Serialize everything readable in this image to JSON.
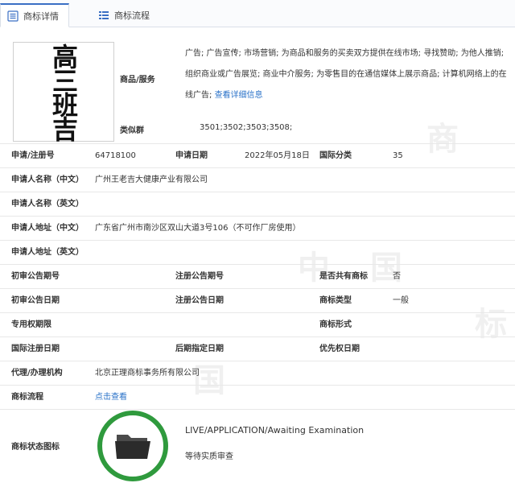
{
  "tabs": [
    {
      "label": "商标详情",
      "icon": "document-icon",
      "active": true
    },
    {
      "label": "商标流程",
      "icon": "list-icon",
      "active": false
    }
  ],
  "watermark": [
    "中",
    "国",
    "商",
    "标"
  ],
  "logo_text": "高三班吉",
  "goods": {
    "label": "商品/服务",
    "text": "广告; 广告宣传; 市场营销; 为商品和服务的买卖双方提供在线市场; 寻找赞助; 为他人推销; 组织商业或广告展览; 商业中介服务; 为零售目的在通信媒体上展示商品; 计算机网络上的在线广告;",
    "link": "查看详细信息"
  },
  "similar_group": {
    "label": "类似群",
    "value": "3501;3502;3503;3508;"
  },
  "rows": {
    "app_no_label": "申请/注册号",
    "app_no": "64718100",
    "app_date_label": "申请日期",
    "app_date": "2022年05月18日",
    "intl_class_label": "国际分类",
    "intl_class": "35",
    "applicant_cn_label": "申请人名称（中文）",
    "applicant_cn": "广州王老吉大健康产业有限公司",
    "applicant_en_label": "申请人名称（英文）",
    "address_cn_label": "申请人地址（中文）",
    "address_cn": "广东省广州市南沙区双山大道3号106（不可作厂房使用）",
    "address_en_label": "申请人地址（英文）",
    "prelim_no_label": "初审公告期号",
    "reg_no_label": "注册公告期号",
    "shared_label": "是否共有商标",
    "shared": "否",
    "prelim_date_label": "初审公告日期",
    "reg_date_label": "注册公告日期",
    "type_label": "商标类型",
    "type": "一般",
    "exclusive_label": "专用权期限",
    "form_label": "商标形式",
    "intl_reg_label": "国际注册日期",
    "later_label": "后期指定日期",
    "priority_label": "优先权日期",
    "agent_label": "代理/办理机构",
    "agent": "北京正理商标事务所有限公司",
    "flow_label": "商标流程",
    "flow_link": "点击查看"
  },
  "status": {
    "label": "商标状态图标",
    "en": "LIVE/APPLICATION/Awaiting Examination",
    "cn": "等待实质审查",
    "icon": "folder-icon",
    "ring_color": "#2f9a3d"
  }
}
